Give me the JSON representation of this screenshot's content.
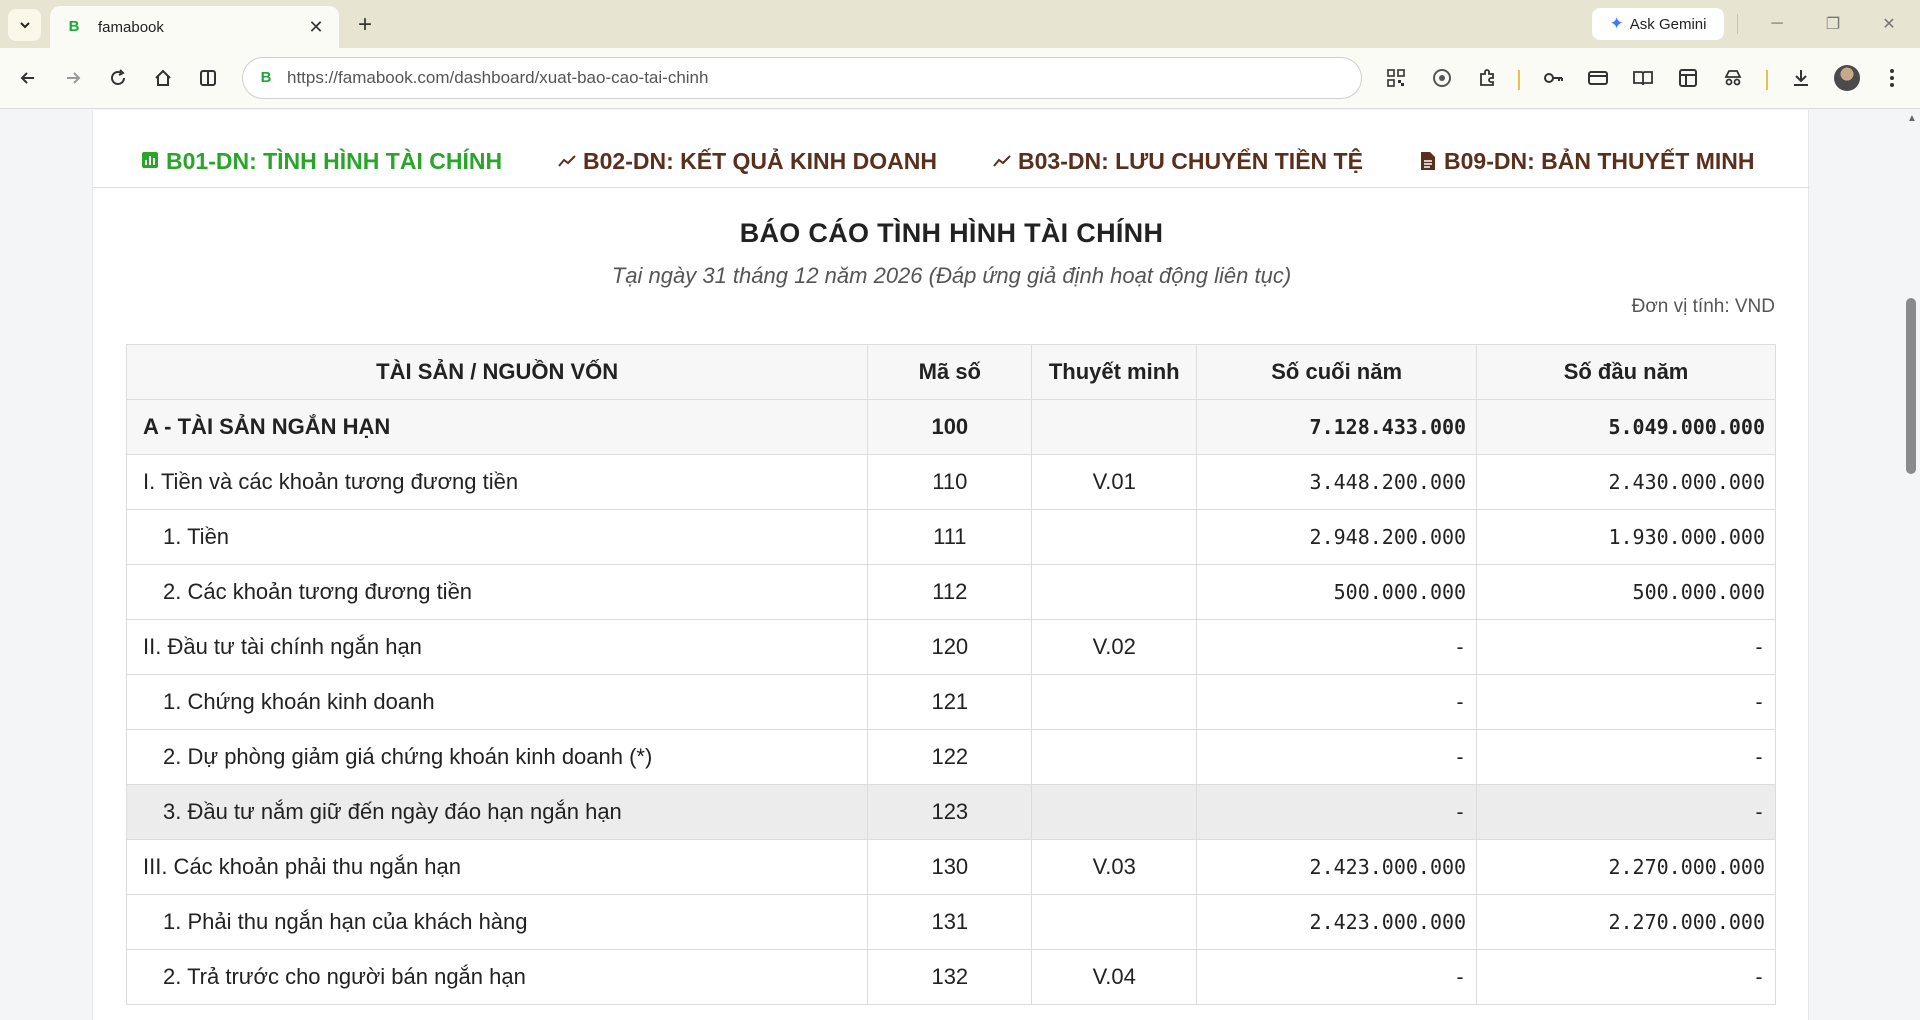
{
  "browser": {
    "tab_title": "famabook",
    "favicon_letter": "B",
    "new_tab_symbol": "+",
    "close_symbol": "✕",
    "ask_gemini_label": "Ask Gemini",
    "url": "https://famabook.com/dashboard/xuat-bao-cao-tai-chinh",
    "accent_color": "#1fa63a"
  },
  "report_tabs": [
    {
      "label": "B01-DN: TÌNH HÌNH TÀI CHÍNH",
      "icon": "bar-chart-icon",
      "active": true
    },
    {
      "label": "B02-DN: KẾT QUẢ KINH DOANH",
      "icon": "trend-line-icon",
      "active": false
    },
    {
      "label": "B03-DN: LƯU CHUYỂN TIỀN TỆ",
      "icon": "trend-line-icon",
      "active": false
    },
    {
      "label": "B09-DN: BẢN THUYẾT MINH",
      "icon": "document-icon",
      "active": false
    }
  ],
  "report": {
    "title": "BÁO CÁO TÌNH HÌNH TÀI CHÍNH",
    "subtitle": "Tại ngày 31 tháng 12 năm 2026 (Đáp ứng giả định hoạt động liên tục)",
    "unit": "Đơn vị tính: VND"
  },
  "table": {
    "headers": [
      "TÀI SẢN / NGUỒN VỐN",
      "Mã số",
      "Thuyết minh",
      "Số cuối năm",
      "Số đầu năm"
    ],
    "rows": [
      {
        "name": "A - TÀI SẢN NGẮN HẠN",
        "code": "100",
        "note": "",
        "end": "7.128.433.000",
        "begin": "5.049.000.000"
      },
      {
        "name": "I. Tiền và các khoản tương đương tiền",
        "code": "110",
        "note": "V.01",
        "end": "3.448.200.000",
        "begin": "2.430.000.000"
      },
      {
        "name": "1. Tiền",
        "code": "111",
        "note": "",
        "end": "2.948.200.000",
        "begin": "1.930.000.000"
      },
      {
        "name": "2. Các khoản tương đương tiền",
        "code": "112",
        "note": "",
        "end": "500.000.000",
        "begin": "500.000.000"
      },
      {
        "name": "II. Đầu tư tài chính ngắn hạn",
        "code": "120",
        "note": "V.02",
        "end": "-",
        "begin": "-"
      },
      {
        "name": "1. Chứng khoán kinh doanh",
        "code": "121",
        "note": "",
        "end": "-",
        "begin": "-"
      },
      {
        "name": "2. Dự phòng giảm giá chứng khoán kinh doanh (*)",
        "code": "122",
        "note": "",
        "end": "-",
        "begin": "-"
      },
      {
        "name": "3. Đầu tư nắm giữ đến ngày đáo hạn ngắn hạn",
        "code": "123",
        "note": "",
        "end": "-",
        "begin": "-"
      },
      {
        "name": "III. Các khoản phải thu ngắn hạn",
        "code": "130",
        "note": "V.03",
        "end": "2.423.000.000",
        "begin": "2.270.000.000"
      },
      {
        "name": "1. Phải thu ngắn hạn của khách hàng",
        "code": "131",
        "note": "",
        "end": "2.423.000.000",
        "begin": "2.270.000.000"
      },
      {
        "name": "2. Trả trước cho người bán ngắn hạn",
        "code": "132",
        "note": "V.04",
        "end": "-",
        "begin": "-"
      }
    ]
  }
}
